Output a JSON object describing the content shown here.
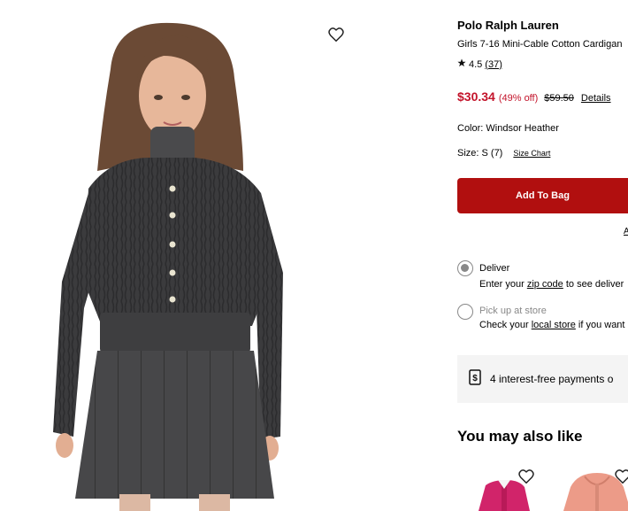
{
  "product": {
    "brand": "Polo Ralph Lauren",
    "name": "Girls 7-16 Mini-Cable Cotton Cardigan",
    "rating": "4.5",
    "review_count": "(37)",
    "sale_price": "$30.34",
    "discount": "(49% off)",
    "original_price": "$59.50",
    "details_label": "Details",
    "color_label": "Color: Windsor Heather",
    "size_label": "Size: S (7)",
    "size_chart_label": "Size Chart",
    "add_to_bag_label": "Add To Bag",
    "truncated_link": "A"
  },
  "fulfillment": {
    "deliver": {
      "title": "Deliver",
      "sub_prefix": "Enter your ",
      "sub_link": "zip code",
      "sub_suffix": " to see deliver"
    },
    "pickup": {
      "title": "Pick up at store",
      "sub_prefix": "Check your ",
      "sub_link": "local store",
      "sub_suffix": " if you want"
    }
  },
  "payments": {
    "text": "4 interest-free payments o"
  },
  "recommendations": {
    "heading": "You may also like"
  },
  "icons": {
    "wishlist": "heart-icon",
    "star": "star-icon",
    "payment": "dollar-card-icon"
  },
  "colors": {
    "sale_red": "#c3132a",
    "bag_button": "#b10f0f",
    "sweater": "#3a3a3c",
    "rec_pink": "#d1246a",
    "rec_coral": "#ec9b88"
  }
}
